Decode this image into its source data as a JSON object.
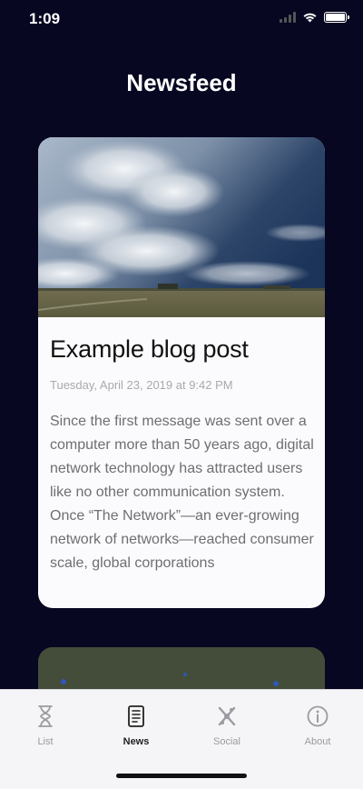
{
  "status_bar": {
    "time": "1:09"
  },
  "header": {
    "title": "Newsfeed"
  },
  "post": {
    "title": "Example blog post",
    "date": "Tuesday, April 23, 2019 at 9:42 PM",
    "body": "Since the first message was sent over a computer more than 50 years ago, digital network technology has attracted users like no other communication system. Once “The Network”—an ever-growing network of networks—reached consumer scale, global corporations"
  },
  "tab_bar": {
    "tabs": [
      {
        "label": "List",
        "icon": "hourglass-icon",
        "active": false
      },
      {
        "label": "News",
        "icon": "newspaper-icon",
        "active": true
      },
      {
        "label": "Social",
        "icon": "social-icon",
        "active": false
      },
      {
        "label": "About",
        "icon": "info-icon",
        "active": false
      }
    ]
  },
  "colors": {
    "background": "#070722",
    "card": "#fbfbfd",
    "tab_bar": "#f5f5f7",
    "tab_inactive": "#9a9aa0",
    "tab_active": "#222222"
  }
}
